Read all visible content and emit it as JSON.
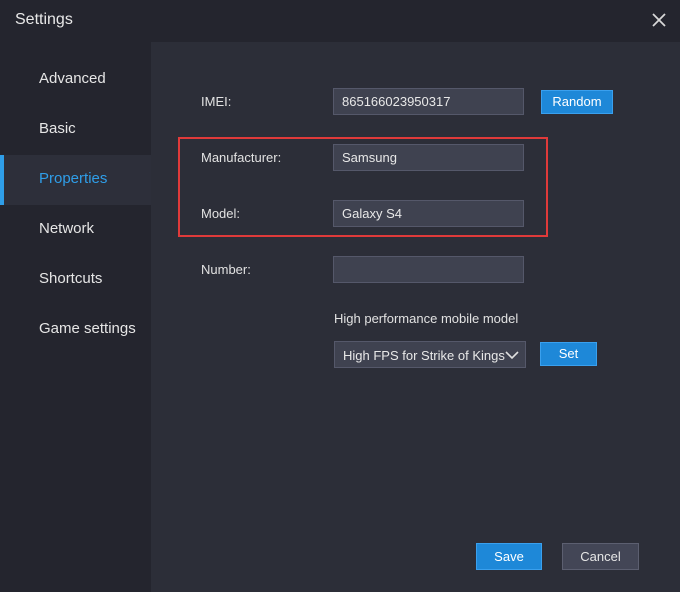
{
  "window": {
    "title": "Settings"
  },
  "sidebar": {
    "items": [
      {
        "label": "Advanced",
        "active": false
      },
      {
        "label": "Basic",
        "active": false
      },
      {
        "label": "Properties",
        "active": true
      },
      {
        "label": "Network",
        "active": false
      },
      {
        "label": "Shortcuts",
        "active": false
      },
      {
        "label": "Game settings",
        "active": false
      }
    ]
  },
  "properties": {
    "imei": {
      "label": "IMEI:",
      "value": "865166023950317"
    },
    "random_label": "Random",
    "manufacturer": {
      "label": "Manufacturer:",
      "value": "Samsung"
    },
    "model": {
      "label": "Model:",
      "value": "Galaxy S4"
    },
    "number": {
      "label": "Number:",
      "value": ""
    },
    "perf_model": {
      "label": "High performance mobile model",
      "selected": "High FPS for Strike of Kings"
    },
    "set_label": "Set"
  },
  "footer": {
    "save_label": "Save",
    "cancel_label": "Cancel"
  },
  "colors": {
    "accent": "#2f9ee8",
    "highlight": "#e03a3a",
    "primary_button": "#1e88d8"
  }
}
